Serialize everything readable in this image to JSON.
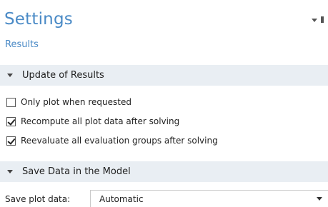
{
  "panel": {
    "title": "Settings",
    "subtitle": "Results"
  },
  "sections": {
    "update": {
      "label": "Update of Results",
      "options": [
        {
          "label": "Only plot when requested",
          "checked": false
        },
        {
          "label": "Recompute all plot data after solving",
          "checked": true
        },
        {
          "label": "Reevaluate all evaluation groups after solving",
          "checked": true
        }
      ]
    },
    "save": {
      "label": "Save Data in the Model",
      "save_plot_label": "Save plot data:",
      "save_plot_value": "Automatic"
    }
  },
  "colors": {
    "accent": "#4a8ac6",
    "section_bg": "#e9eef3"
  },
  "icons": {
    "header_menu": "chevron-down-icon",
    "pin": "pin-icon",
    "section_toggle": "triangle-down-icon",
    "select_arrow": "chevron-down-icon"
  }
}
